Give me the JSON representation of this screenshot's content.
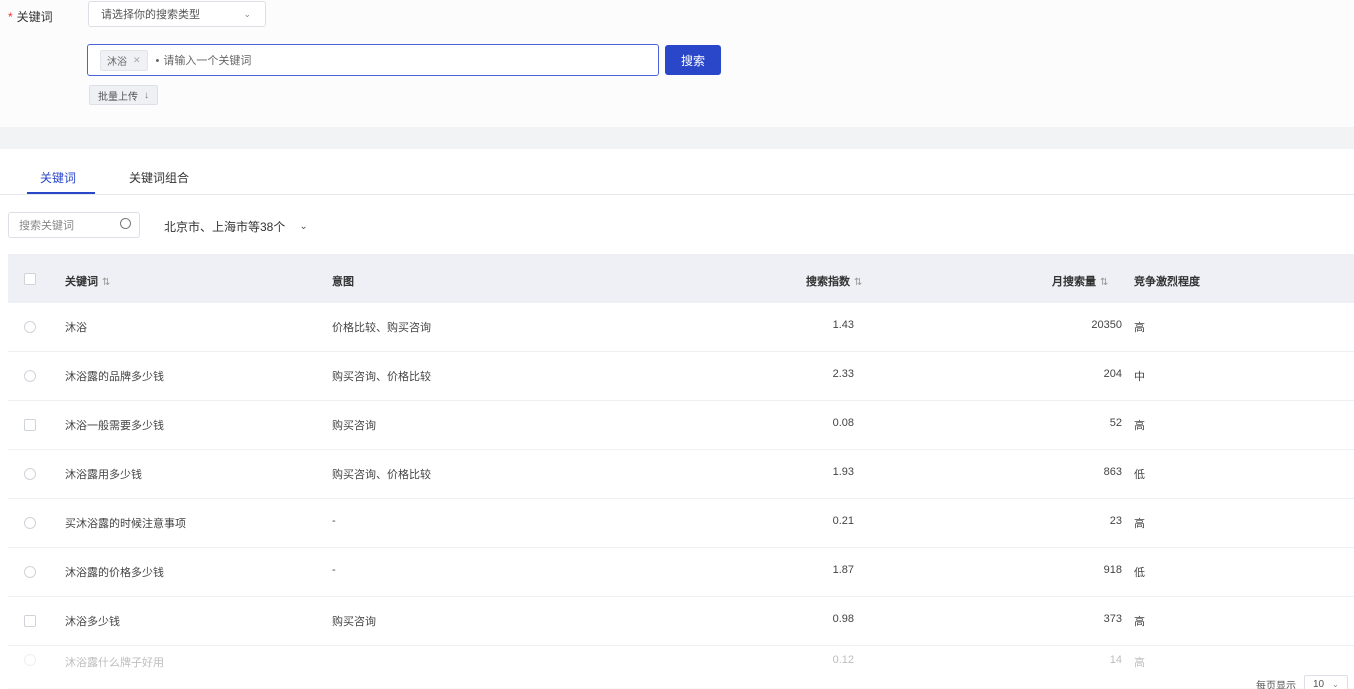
{
  "form": {
    "required_label": "关键词",
    "required_mark": "*",
    "mode_select": "请选择你的搜索类型",
    "mode_caret": "⌄"
  },
  "search": {
    "tag_label": "沐浴",
    "tag_close": "✕",
    "placeholder_dot": "•",
    "placeholder": "请输入一个关键词",
    "submit_label": "搜索",
    "upload_label": "批量上传",
    "upload_arrow": "↓"
  },
  "tabs": [
    {
      "label": "关键词",
      "active": true
    },
    {
      "label": "关键词组合"
    }
  ],
  "filters": {
    "keyword_placeholder": "搜索关键词",
    "region_label": "北京市、上海市等38个",
    "region_caret": "⌄"
  },
  "table": {
    "headers": {
      "keyword": "关键词",
      "intent": "意图",
      "index": "搜索指数",
      "volume": "月搜索量",
      "competition": "竞争激烈程度"
    },
    "sort_glyph": "⇅",
    "rows": [
      {
        "keyword": "沐浴",
        "intent": "价格比较、购买咨询",
        "index": "1.43",
        "volume": "20350",
        "competition": "高"
      },
      {
        "keyword": "沐浴露的品牌多少钱",
        "intent": "购买咨询、价格比较",
        "index": "2.33",
        "volume": "204",
        "competition": "中"
      },
      {
        "keyword": "沐浴一般需要多少钱",
        "intent": "购买咨询",
        "index": "0.08",
        "volume": "52",
        "competition": "高"
      },
      {
        "keyword": "沐浴露用多少钱",
        "intent": "购买咨询、价格比较",
        "index": "1.93",
        "volume": "863",
        "competition": "低"
      },
      {
        "keyword": "买沐浴露的时候注意事项",
        "intent": "-",
        "index": "0.21",
        "volume": "23",
        "competition": "高"
      },
      {
        "keyword": "沐浴露的价格多少钱",
        "intent": "-",
        "index": "1.87",
        "volume": "918",
        "competition": "低"
      },
      {
        "keyword": "沐浴多少钱",
        "intent": "购买咨询",
        "index": "0.98",
        "volume": "373",
        "competition": "高"
      },
      {
        "keyword": "沐浴露什么牌子好用",
        "intent": "",
        "index": "0.12",
        "volume": "14",
        "competition": "高"
      }
    ]
  },
  "pager": {
    "label": "每页显示",
    "page_size": "10",
    "caret": "⌄"
  }
}
